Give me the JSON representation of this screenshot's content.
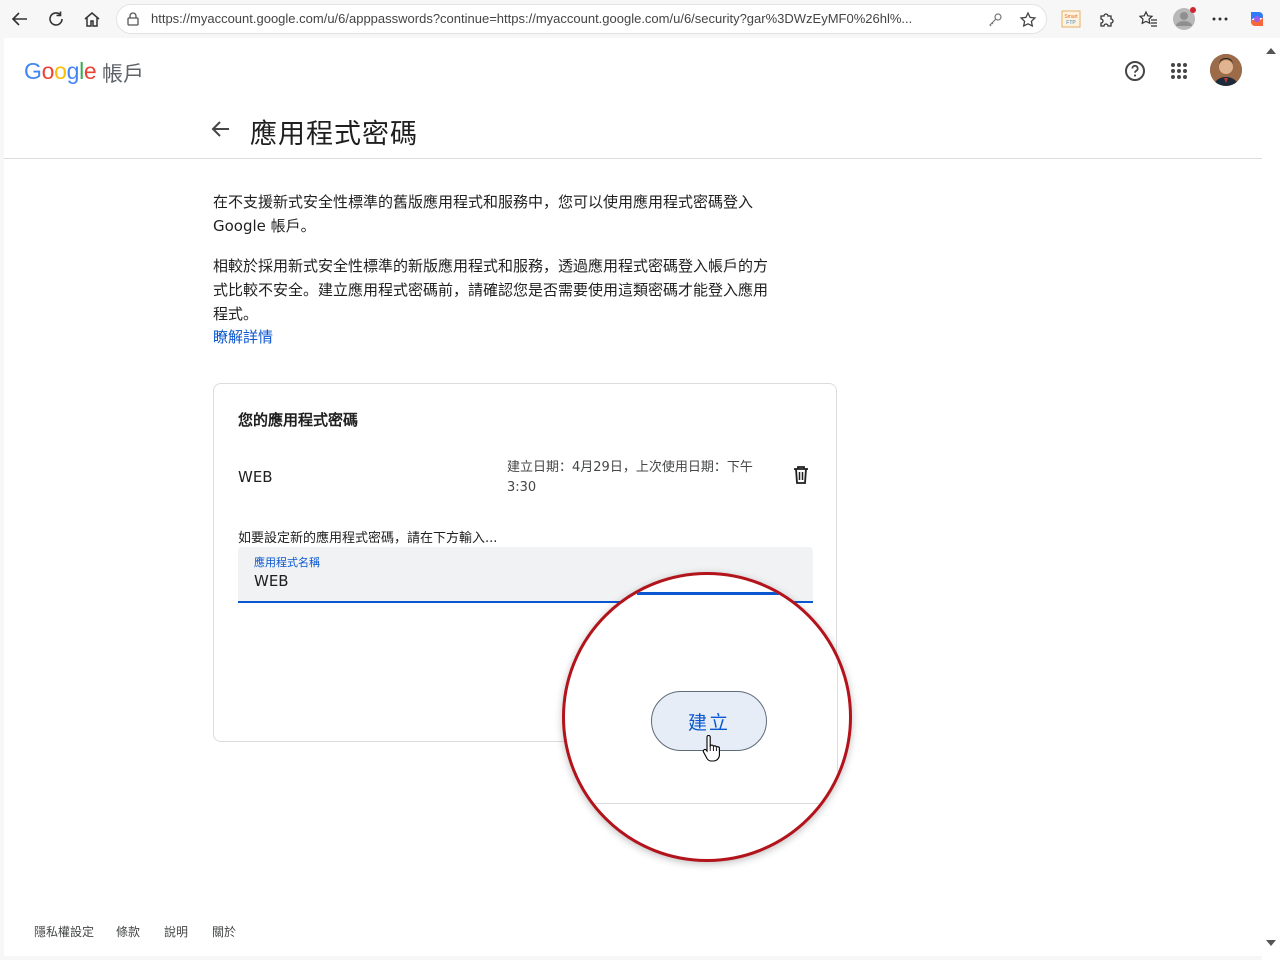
{
  "browser": {
    "url": "https://myaccount.google.com/u/6/apppasswords?continue=https://myaccount.google.com/u/6/security?gar%3DWzEyMF0%26hl%...",
    "extension_label": "Smart\nFTP"
  },
  "header": {
    "logo_text": "Google",
    "product_name": "帳戶"
  },
  "page": {
    "title": "應用程式密碼",
    "intro_1": "在不支援新式安全性標準的舊版應用程式和服務中，您可以使用應用程式密碼登入 Google 帳戶。",
    "intro_2": "相較於採用新式安全性標準的新版應用程式和服務，透過應用程式密碼登入帳戶的方式比較不安全。建立應用程式密碼前，請確認您是否需要使用這類密碼才能登入應用程式。",
    "learn_more": "瞭解詳情"
  },
  "card": {
    "heading": "您的應用程式密碼",
    "passwords": [
      {
        "name": "WEB",
        "meta": "建立日期：4月29日，上次使用日期：下午 3:30"
      }
    ],
    "new_hint": "如要設定新的應用程式密碼，請在下方輸入...",
    "field": {
      "label": "應用程式名稱",
      "value": "WEB"
    },
    "create_button": "建立"
  },
  "footer": {
    "links": [
      "隱私權設定",
      "條款",
      "說明",
      "關於"
    ]
  },
  "colors": {
    "accent": "#0b57d0",
    "highlight_ring": "#b3131b"
  }
}
